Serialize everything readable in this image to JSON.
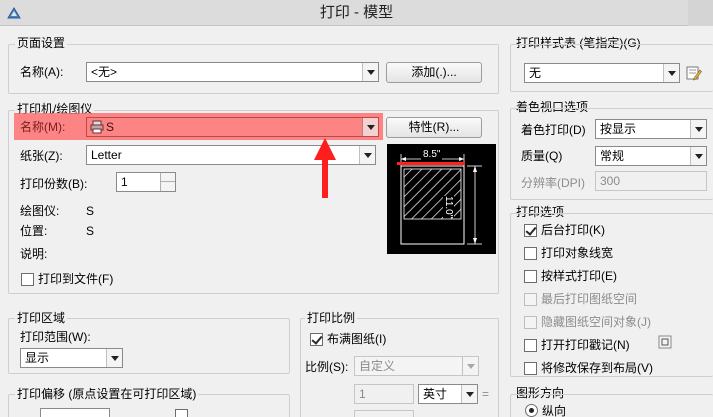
{
  "window": {
    "title": "打印 - 模型"
  },
  "page_setup": {
    "group_title": "页面设置",
    "name_label": "名称(A):",
    "name_value": "<无>",
    "add_button": "添加(.)..."
  },
  "printer": {
    "group_title": "打印机/绘图仪",
    "name_label": "名称(M):",
    "name_value": "S",
    "properties_button": "特性(R)...",
    "paper_label": "纸张(Z):",
    "paper_value": "Letter",
    "copies_label": "打印份数(B):",
    "copies_value": "1",
    "plotter_label": "绘图仪:",
    "plotter_value": "S",
    "location_label": "位置:",
    "location_value": "S",
    "description_label": "说明:",
    "print_to_file_label": "打印到文件(F)",
    "preview_width": "8.5\"",
    "preview_height": "11.0\""
  },
  "plot_area": {
    "group_title": "打印区域",
    "range_label": "打印范围(W):",
    "range_value": "显示"
  },
  "plot_offset": {
    "group_title": "打印偏移 (原点设置在可打印区域)"
  },
  "plot_scale": {
    "group_title": "打印比例",
    "fit_label": "布满图纸(I)",
    "scale_label": "比例(S):",
    "scale_value": "自定义",
    "scale_number": "1",
    "unit_value": "英寸",
    "equals": "="
  },
  "plot_style_table": {
    "group_title": "打印样式表 (笔指定)(G)",
    "value": "无"
  },
  "shaded_viewport": {
    "group_title": "着色视口选项",
    "shade_label": "着色打印(D)",
    "shade_value": "按显示",
    "quality_label": "质量(Q)",
    "quality_value": "常规",
    "dpi_label": "分辨率(DPI)",
    "dpi_value": "300"
  },
  "plot_options": {
    "group_title": "打印选项",
    "items": [
      {
        "label": "后台打印(K)",
        "checked": true,
        "enabled": true
      },
      {
        "label": "打印对象线宽",
        "checked": false,
        "enabled": true
      },
      {
        "label": "按样式打印(E)",
        "checked": false,
        "enabled": true
      },
      {
        "label": "最后打印图纸空间",
        "checked": false,
        "enabled": false
      },
      {
        "label": "隐藏图纸空间对象(J)",
        "checked": false,
        "enabled": false
      },
      {
        "label": "打开打印戳记(N)",
        "checked": false,
        "enabled": true
      },
      {
        "label": "将修改保存到布局(V)",
        "checked": false,
        "enabled": true
      }
    ]
  },
  "drawing_orientation": {
    "group_title": "图形方向",
    "portrait_label": "纵向"
  },
  "colors": {
    "highlight": "#ff6b6b",
    "arrow": "#ff1e1e",
    "preview_bg": "#000000"
  }
}
